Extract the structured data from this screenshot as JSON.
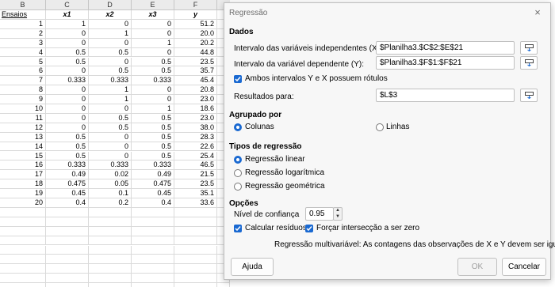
{
  "sheet": {
    "columns": [
      "B",
      "C",
      "D",
      "E",
      "F"
    ],
    "header_row": [
      "Ensaios",
      "x1",
      "x2",
      "x3",
      "y"
    ],
    "rows": [
      [
        "1",
        "1",
        "0",
        "0",
        "51.2"
      ],
      [
        "2",
        "0",
        "1",
        "0",
        "20.0"
      ],
      [
        "3",
        "0",
        "0",
        "1",
        "20.2"
      ],
      [
        "4",
        "0.5",
        "0.5",
        "0",
        "44.8"
      ],
      [
        "5",
        "0.5",
        "0",
        "0.5",
        "23.5"
      ],
      [
        "6",
        "0",
        "0.5",
        "0.5",
        "35.7"
      ],
      [
        "7",
        "0.333",
        "0.333",
        "0.333",
        "45.4"
      ],
      [
        "8",
        "0",
        "1",
        "0",
        "20.8"
      ],
      [
        "9",
        "0",
        "1",
        "0",
        "23.0"
      ],
      [
        "10",
        "0",
        "0",
        "1",
        "18.6"
      ],
      [
        "11",
        "0",
        "0.5",
        "0.5",
        "23.0"
      ],
      [
        "12",
        "0",
        "0.5",
        "0.5",
        "38.0"
      ],
      [
        "13",
        "0.5",
        "0",
        "0.5",
        "28.3"
      ],
      [
        "14",
        "0.5",
        "0",
        "0.5",
        "22.6"
      ],
      [
        "15",
        "0.5",
        "0",
        "0.5",
        "25.4"
      ],
      [
        "16",
        "0.333",
        "0.333",
        "0.333",
        "46.5"
      ],
      [
        "17",
        "0.49",
        "0.02",
        "0.49",
        "21.5"
      ],
      [
        "18",
        "0.475",
        "0.05",
        "0.475",
        "23.5"
      ],
      [
        "19",
        "0.45",
        "0.1",
        "0.45",
        "35.1"
      ],
      [
        "20",
        "0.4",
        "0.2",
        "0.4",
        "33.6"
      ]
    ]
  },
  "dialog": {
    "title": "Regressão",
    "close_icon": "×",
    "dados": {
      "heading": "Dados",
      "x_label": "Intervalo das variáveis independentes (X):",
      "x_value": "$Planilha3.$C$2:$E$21",
      "y_label": "Intervalo da variável dependente (Y):",
      "y_value": "$Planilha3.$F$1:$F$21",
      "labels_checkbox": "Ambos intervalos Y e X possuem rótulos",
      "labels_checked": true,
      "results_label": "Resultados para:",
      "results_value": "$L$3"
    },
    "agrupado": {
      "heading": "Agrupado por",
      "options": [
        "Colunas",
        "Linhas"
      ],
      "selected": "Colunas"
    },
    "tipos": {
      "heading": "Tipos de regressão",
      "options": [
        "Regressão linear",
        "Regressão logarítmica",
        "Regressão geométrica"
      ],
      "selected": "Regressão linear"
    },
    "opcoes": {
      "heading": "Opções",
      "confidence_label": "Nível de confiança",
      "confidence_value": "0.95",
      "residuals_label": "Calcular resíduos",
      "residuals_checked": true,
      "zero_intercept_label": "Forçar intersecção a ser zero",
      "zero_intercept_checked": true
    },
    "message": "Regressão multivariável: As contagens das observações de X e Y devem ser iguais",
    "buttons": {
      "help": "Ajuda",
      "ok": "OK",
      "cancel": "Cancelar"
    },
    "colors": {
      "accent": "#1a69d1",
      "disabled_text": "#9f9f9f"
    }
  }
}
